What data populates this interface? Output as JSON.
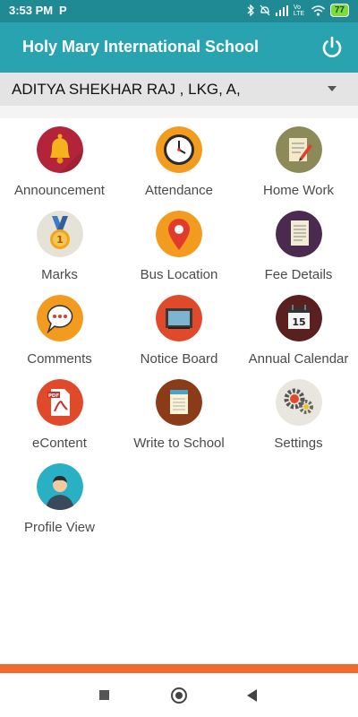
{
  "statusbar": {
    "time": "3:53 PM",
    "p_label": "P",
    "battery": "77",
    "network": "Vo LTE"
  },
  "app": {
    "title": "Holy Mary International School"
  },
  "student": {
    "selected": "ADITYA SHEKHAR RAJ , LKG, A,"
  },
  "menu": [
    {
      "label": "Announcement",
      "icon": "bell-icon"
    },
    {
      "label": "Attendance",
      "icon": "clock-icon"
    },
    {
      "label": "Home Work",
      "icon": "notebook-pencil-icon"
    },
    {
      "label": "Marks",
      "icon": "medal-icon"
    },
    {
      "label": "Bus Location",
      "icon": "location-pin-icon"
    },
    {
      "label": "Fee Details",
      "icon": "document-list-icon"
    },
    {
      "label": "Comments",
      "icon": "speech-bubble-icon"
    },
    {
      "label": "Notice Board",
      "icon": "notice-board-icon"
    },
    {
      "label": "Annual Calendar",
      "icon": "calendar-icon"
    },
    {
      "label": "eContent",
      "icon": "pdf-icon"
    },
    {
      "label": "Write to School",
      "icon": "notepad-icon"
    },
    {
      "label": "Settings",
      "icon": "gears-icon"
    },
    {
      "label": "Profile View",
      "icon": "user-avatar-icon"
    }
  ],
  "colors": {
    "statusbar": "#1f8a94",
    "appbar": "#2aa3b0",
    "accent_bar": "#f26a2b"
  }
}
